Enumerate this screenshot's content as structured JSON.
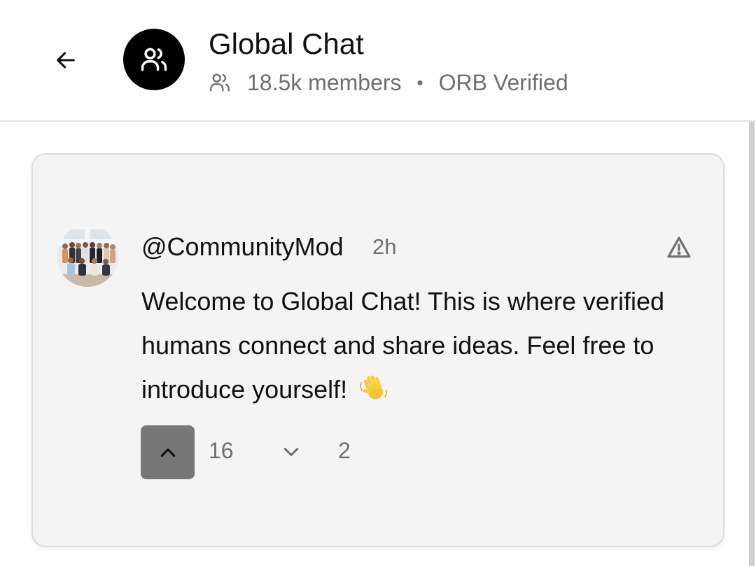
{
  "header": {
    "title": "Global Chat",
    "members": "18.5k members",
    "separator": "•",
    "verified": "ORB Verified",
    "icons": {
      "back": "arrow-left-icon",
      "group": "users-icon",
      "members": "users-icon"
    }
  },
  "message": {
    "username": "@CommunityMod",
    "time": "2h",
    "text": "Welcome to Global Chat! This is where verified humans connect and share ideas. Feel free to introduce yourself!",
    "emoji": "waving-hand-emoji",
    "upvotes": "16",
    "downvotes": "2",
    "icons": {
      "report": "warning-triangle-icon",
      "upvote": "chevron-up-icon",
      "downvote": "chevron-down-icon"
    }
  },
  "colors": {
    "card_background": "#f4f4f4",
    "avatar_background": "#000000",
    "muted_text": "#6f6f6f",
    "upvote_active": "#777777"
  }
}
